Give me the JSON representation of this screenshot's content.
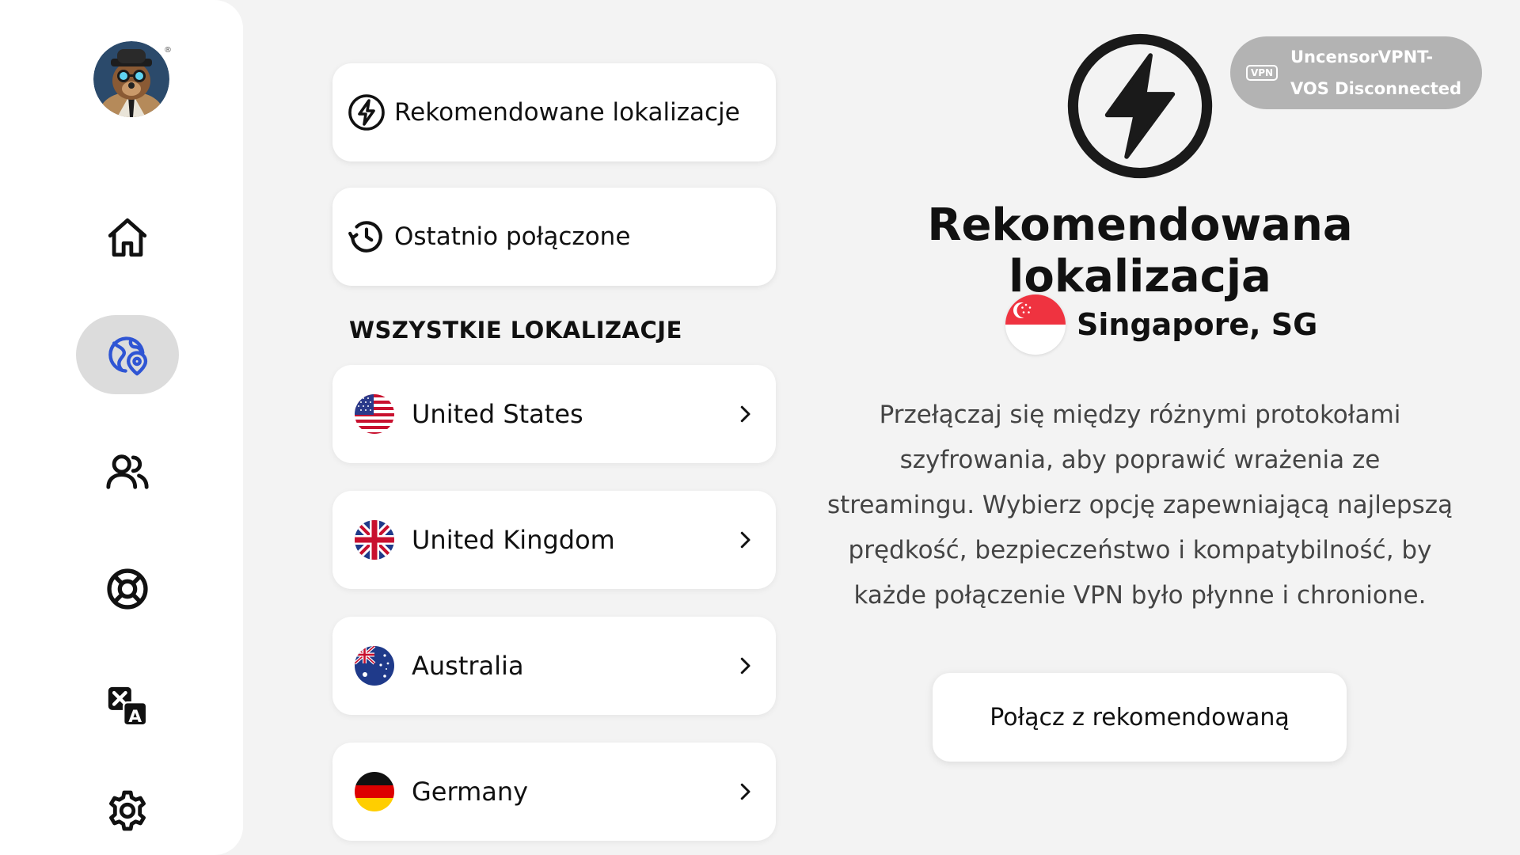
{
  "sidebar": {
    "avatar_mark": "®",
    "items": [
      {
        "icon": "home-icon",
        "active": false
      },
      {
        "icon": "globe-location-icon",
        "active": true
      },
      {
        "icon": "users-icon",
        "active": false
      },
      {
        "icon": "lifebuoy-icon",
        "active": false
      },
      {
        "icon": "translate-icon",
        "active": false
      },
      {
        "icon": "gear-icon",
        "active": false
      }
    ]
  },
  "menu": {
    "recommended_label": "Rekomendowane lokalizacje",
    "recent_label": "Ostatnio połączone"
  },
  "locations": {
    "section_title": "WSZYSTKIE LOKALIZACJE",
    "items": [
      {
        "name": "United States",
        "flag": "us-flag"
      },
      {
        "name": "United Kingdom",
        "flag": "uk-flag"
      },
      {
        "name": "Australia",
        "flag": "au-flag"
      },
      {
        "name": "Germany",
        "flag": "de-flag"
      }
    ]
  },
  "status": {
    "badge": "VPN",
    "line1": "UncensorVPNT-",
    "line2": "VOS Disconnected"
  },
  "recommended": {
    "title": "Rekomendowana lokalizacja",
    "location": "Singapore, SG",
    "desc_lines": [
      "Przełączaj się między różnymi protokołami",
      "szyfrowania, aby poprawić wrażenia ze",
      "streamingu. Wybierz opcję zapewniającą najlepszą",
      "prędkość, bezpieczeństwo i kompatybilność, by",
      "każde połączenie VPN było płynne i chronione."
    ],
    "connect_label": "Połącz z rekomendowaną"
  },
  "colors": {
    "accent": "#2f55d4",
    "background": "#f3f3f3",
    "status_pill": "#b3b3b3"
  }
}
